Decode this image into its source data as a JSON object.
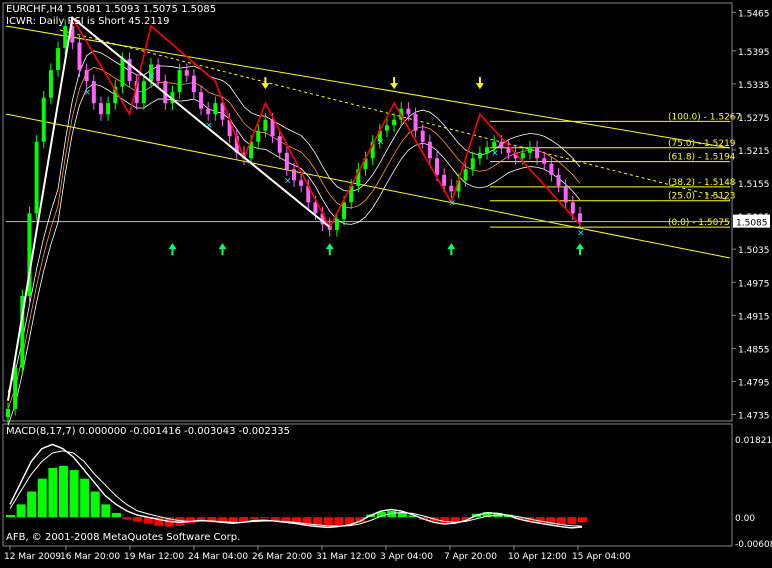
{
  "window": {
    "title": "EURCHF,H4  1.5081 1.5093 1.5075 1.5085",
    "indicator_label": "ICWR: Daily RSI is Short 45.2119",
    "copyright": "AFB, © 2001-2008 MetaQuotes Software Corp.",
    "current_price": "1.5085"
  },
  "colors": {
    "background": "#000000",
    "bull_candle": "#00ff00",
    "bear_candle": "#ff66ff",
    "bollinger": "#ffffff",
    "channel": "#ffff00",
    "zigzag": "#ff0000",
    "wave_line": "#ffffff",
    "up_arrow": "#00ff66",
    "down_arrow": "#ffff00",
    "fractal_mark": "#00ffff",
    "macd_pos": "#00ff00",
    "macd_neg": "#ff0000",
    "axis_text": "#ffffff",
    "grid_line": "#c0c0c0",
    "fibo": "#ffff00",
    "current_price_line": "#aabbdd"
  },
  "chart_data": [
    {
      "type": "line",
      "symbol": "EURCHF",
      "timeframe": "H4",
      "ohlc": {
        "open": 1.5081,
        "high": 1.5093,
        "low": 1.5075,
        "close": 1.5085
      },
      "x_ticks": [
        "12 Mar 2009",
        "16 Mar 20:00",
        "19 Mar 12:00",
        "24 Mar 04:00",
        "26 Mar 20:00",
        "31 Mar 12:00",
        "3 Apr 04:00",
        "7 Apr 20:00",
        "10 Apr 12:00",
        "15 Apr 04:00"
      ],
      "y_ticks": [
        1.5465,
        1.5395,
        1.5335,
        1.5275,
        1.5215,
        1.5155,
        1.5095,
        1.5035,
        1.4975,
        1.4915,
        1.4855,
        1.4795,
        1.4735
      ],
      "ylim": [
        1.4725,
        1.548
      ],
      "close_series": [
        1.4745,
        1.482,
        1.495,
        1.51,
        1.523,
        1.531,
        1.536,
        1.54,
        1.544,
        1.541,
        1.536,
        1.534,
        1.53,
        1.528,
        1.53,
        1.533,
        1.538,
        1.534,
        1.53,
        1.534,
        1.537,
        1.534,
        1.53,
        1.532,
        1.536,
        1.535,
        1.532,
        1.529,
        1.528,
        1.53,
        1.527,
        1.524,
        1.521,
        1.52,
        1.523,
        1.525,
        1.527,
        1.524,
        1.521,
        1.518,
        1.516,
        1.515,
        1.512,
        1.51,
        1.508,
        1.507,
        1.509,
        1.512,
        1.515,
        1.518,
        1.52,
        1.523,
        1.525,
        1.526,
        1.527,
        1.529,
        1.528,
        1.525,
        1.523,
        1.52,
        1.517,
        1.515,
        1.514,
        1.516,
        1.518,
        1.52,
        1.521,
        1.522,
        1.523,
        1.522,
        1.521,
        1.52,
        1.521,
        1.522,
        1.52,
        1.519,
        1.517,
        1.515,
        1.512,
        1.51,
        1.5085
      ],
      "zigzag": [
        {
          "t": "16 Mar 00:00",
          "price": 1.5455
        },
        {
          "t": "18 Mar 12:00",
          "price": 1.528
        },
        {
          "t": "19 Mar 12:00",
          "price": 1.544
        },
        {
          "t": "23 Mar 04:00",
          "price": 1.534
        },
        {
          "t": "24 Mar 20:00",
          "price": 1.52
        },
        {
          "t": "26 Mar 04:00",
          "price": 1.53
        },
        {
          "t": "31 Mar 12:00",
          "price": 1.5075
        },
        {
          "t": "3 Apr 04:00",
          "price": 1.53
        },
        {
          "t": "7 Apr 04:00",
          "price": 1.512
        },
        {
          "t": "8 Apr 12:00",
          "price": 1.528
        },
        {
          "t": "14 Apr 20:00",
          "price": 1.508
        }
      ],
      "fibo_levels": [
        {
          "label": "(100.0) - 1.5267",
          "price": 1.5267
        },
        {
          "label": "(75.0) - 1.5219",
          "price": 1.5219
        },
        {
          "label": "(61.8) - 1.5194",
          "price": 1.5194
        },
        {
          "label": "(38.2) - 1.5148",
          "price": 1.5148
        },
        {
          "label": "(25.0) - 1.5123",
          "price": 1.5123
        },
        {
          "label": "(0.0) - 1.5075",
          "price": 1.5075
        }
      ]
    },
    {
      "type": "bar",
      "indicator": "MACD",
      "label": "MACD(8,17,7) 0.000000 -0.001416 -0.003043 -0.002335",
      "y_ticks": [
        0.018217,
        0.0,
        -0.006086
      ],
      "ylim": [
        -0.0065,
        0.0185
      ],
      "histogram": [
        0.0005,
        0.003,
        0.006,
        0.009,
        0.0115,
        0.012,
        0.011,
        0.009,
        0.006,
        0.003,
        0.001,
        -0.0005,
        -0.001,
        -0.0015,
        -0.002,
        -0.0022,
        -0.002,
        -0.0015,
        -0.001,
        -0.0012,
        -0.0014,
        -0.0016,
        -0.001,
        -0.0005,
        -0.0003,
        -0.0008,
        -0.0012,
        -0.0015,
        -0.0018,
        -0.002,
        -0.0022,
        -0.002,
        -0.0017,
        -0.0012,
        0.0006,
        0.0012,
        0.0015,
        0.001,
        0.0004,
        -0.0006,
        -0.0012,
        -0.0015,
        -0.0012,
        -0.0008,
        0.0008,
        0.0012,
        0.001,
        0.0006,
        -0.0004,
        -0.001,
        -0.0013,
        -0.0016,
        -0.0018,
        -0.0016,
        -0.0012
      ],
      "macd_line": [
        0.003,
        0.008,
        0.013,
        0.016,
        0.017,
        0.016,
        0.014,
        0.011,
        0.008,
        0.005,
        0.003,
        0.0015,
        0.0005,
        0.0,
        -0.0005,
        -0.001,
        -0.0012,
        -0.001,
        -0.0008,
        -0.0009,
        -0.0012,
        -0.0014,
        -0.0012,
        -0.0008,
        -0.0007,
        -0.0009,
        -0.0012,
        -0.0015,
        -0.0019,
        -0.0022,
        -0.0024,
        -0.0022,
        -0.0018,
        -0.001,
        0.0004,
        0.0014,
        0.0018,
        0.0014,
        0.0006,
        -0.0004,
        -0.0012,
        -0.0016,
        -0.0014,
        -0.0008,
        0.0004,
        0.001,
        0.0009,
        0.0004,
        -0.0004,
        -0.001,
        -0.0014,
        -0.0018,
        -0.0022,
        -0.0025,
        -0.0023
      ],
      "signal_line": [
        0.002,
        0.006,
        0.01,
        0.013,
        0.015,
        0.0155,
        0.015,
        0.013,
        0.01,
        0.0075,
        0.005,
        0.003,
        0.0015,
        0.0008,
        0.0002,
        -0.0004,
        -0.0008,
        -0.001,
        -0.0009,
        -0.0009,
        -0.001,
        -0.0012,
        -0.0012,
        -0.001,
        -0.0009,
        -0.0009,
        -0.001,
        -0.0012,
        -0.0015,
        -0.0018,
        -0.002,
        -0.0021,
        -0.002,
        -0.0016,
        -0.0008,
        0.0002,
        0.0009,
        0.0011,
        0.0009,
        0.0003,
        -0.0004,
        -0.001,
        -0.0012,
        -0.001,
        -0.0004,
        0.0002,
        0.0005,
        0.0005,
        0.0001,
        -0.0004,
        -0.0009,
        -0.0013,
        -0.0017,
        -0.002,
        -0.0021
      ]
    }
  ]
}
